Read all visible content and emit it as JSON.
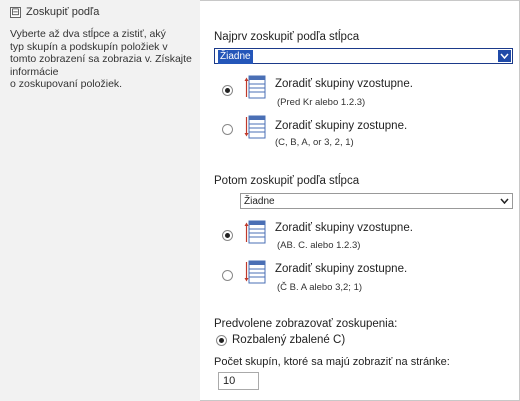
{
  "section": {
    "toggle_symbol": "⊟",
    "title": "Zoskupiť podľa",
    "description": "Vyberte až dva stĺpce a zistiť, aký\n typ skupín a podskupín položiek v\n tomto zobrazení sa zobrazia v. Získajte informácie\n o zoskupovaní položiek."
  },
  "group1": {
    "label": "Najprv zoskupiť podľa stĺpca",
    "selected": "Žiadne",
    "ascending": {
      "title": "Zoradiť skupiny vzostupne.",
      "example": "(Pred Kr alebo 1.2.3)",
      "checked": true
    },
    "descending": {
      "title": "Zoradiť skupiny zostupne.",
      "example": "(C, B, A, or 3, 2, 1)",
      "checked": false
    }
  },
  "group2": {
    "label": "Potom zoskupiť podľa stĺpca",
    "selected": "Žiadne",
    "ascending": {
      "title": "Zoradiť skupiny vzostupne.",
      "example": "(AB. C. alebo 1.2.3)",
      "checked": true
    },
    "descending": {
      "title": "Zoradiť skupiny zostupne.",
      "example": "(Č B. A alebo 3,2; 1)",
      "checked": false
    }
  },
  "default_display": {
    "label": "Predvolene zobrazovať zoskupenia:",
    "option": "Rozbalený zbalené C)",
    "checked": true
  },
  "page_count": {
    "label": "Počet skupín, ktoré sa majú zobraziť na stránke:",
    "value": "10"
  },
  "colors": {
    "left_panel_bg": "#f2f2f2",
    "highlight": "#2456b9",
    "icon_blue": "#4a6fb5",
    "icon_red": "#c0392b"
  }
}
